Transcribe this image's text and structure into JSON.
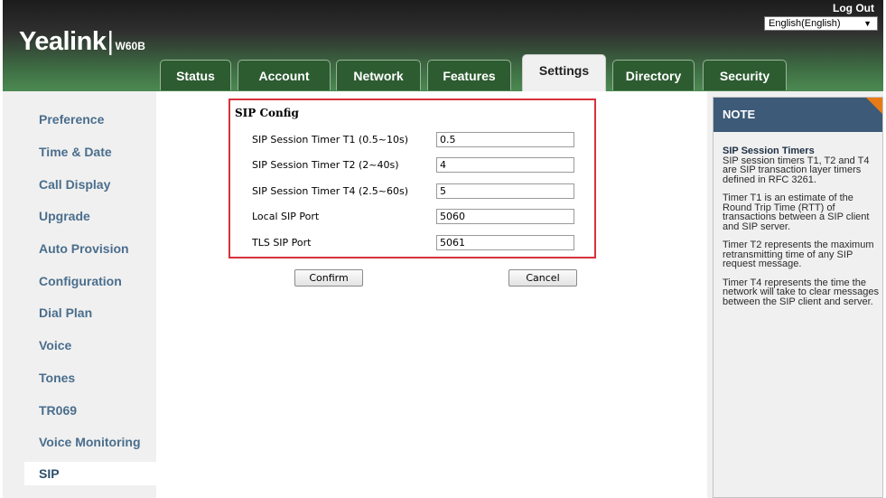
{
  "header": {
    "brand": "Yealink",
    "model": "W60B",
    "logout": "Log Out",
    "language": "English(English)"
  },
  "tabs": [
    {
      "label": "Status"
    },
    {
      "label": "Account"
    },
    {
      "label": "Network"
    },
    {
      "label": "Features"
    },
    {
      "label": "Settings",
      "active": true
    },
    {
      "label": "Directory"
    },
    {
      "label": "Security"
    }
  ],
  "sidebar": {
    "items": [
      {
        "label": "Preference"
      },
      {
        "label": "Time & Date"
      },
      {
        "label": "Call Display"
      },
      {
        "label": "Upgrade"
      },
      {
        "label": "Auto Provision"
      },
      {
        "label": "Configuration"
      },
      {
        "label": "Dial Plan"
      },
      {
        "label": "Voice"
      },
      {
        "label": "Tones"
      },
      {
        "label": "TR069"
      },
      {
        "label": "Voice Monitoring"
      },
      {
        "label": "SIP",
        "active": true
      }
    ]
  },
  "sip_config": {
    "title": "SIP Config",
    "rows": [
      {
        "label": "SIP Session Timer T1 (0.5~10s)",
        "value": "0.5"
      },
      {
        "label": "SIP Session Timer T2 (2~40s)",
        "value": "4"
      },
      {
        "label": "SIP Session Timer T4 (2.5~60s)",
        "value": "5"
      },
      {
        "label": "Local SIP Port",
        "value": "5060"
      },
      {
        "label": "TLS SIP Port",
        "value": "5061"
      }
    ]
  },
  "buttons": {
    "confirm": "Confirm",
    "cancel": "Cancel"
  },
  "note": {
    "heading": "NOTE",
    "title": "SIP Session Timers",
    "p1": "SIP session timers T1, T2 and T4 are SIP transaction layer timers defined in RFC 3261.",
    "p2": "Timer T1 is an estimate of the Round Trip Time (RTT) of transactions between a SIP client and SIP server.",
    "p3": "Timer T2 represents the maximum retransmitting time of any SIP request message.",
    "p4": "Timer T4 represents the time the network will take to clear messages between the SIP client and server."
  },
  "colors": {
    "accent_red": "#d6323c",
    "note_header": "#3d5a78",
    "note_corner": "#e97b16",
    "sidebar_text": "#4a6e8d",
    "tab_bg": "#2d5c31"
  }
}
